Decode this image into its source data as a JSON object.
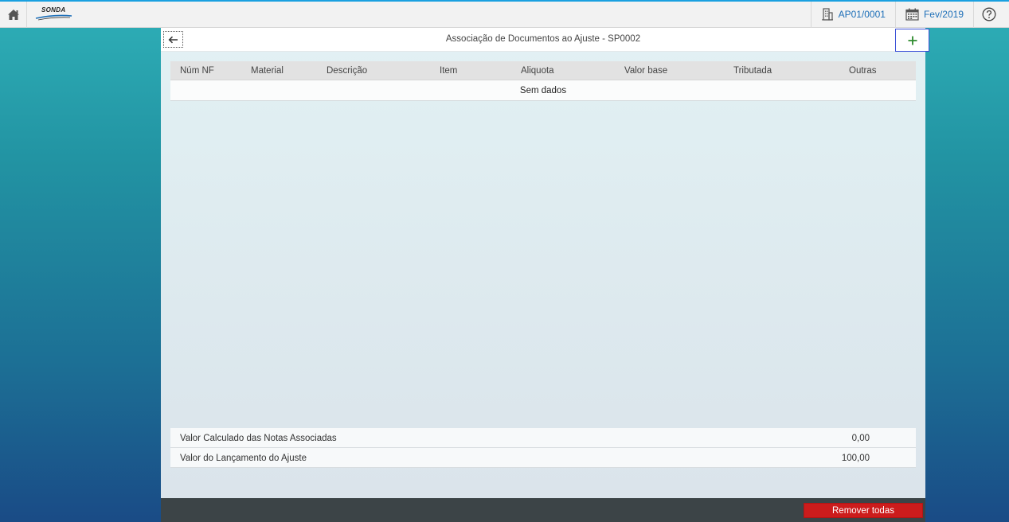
{
  "topbar": {
    "logo_text": "SONDA",
    "company": "AP01/0001",
    "period": "Fev/2019"
  },
  "panel": {
    "title": "Associação de Documentos ao Ajuste - SP0002"
  },
  "table": {
    "columns": [
      "Núm NF",
      "Material",
      "Descrição",
      "Item",
      "Aliquota",
      "Valor base",
      "Tributada",
      "Outras"
    ],
    "empty_text": "Sem dados"
  },
  "summary": [
    {
      "label": "Valor Calculado das Notas Associadas",
      "value": "0,00"
    },
    {
      "label": "Valor do Lançamento do Ajuste",
      "value": "100,00"
    }
  ],
  "footer": {
    "remove_all_label": "Remover todas"
  },
  "colors": {
    "accent": "#1d6fb8",
    "danger": "#cc1c1c",
    "add": "#2e8b2e"
  }
}
